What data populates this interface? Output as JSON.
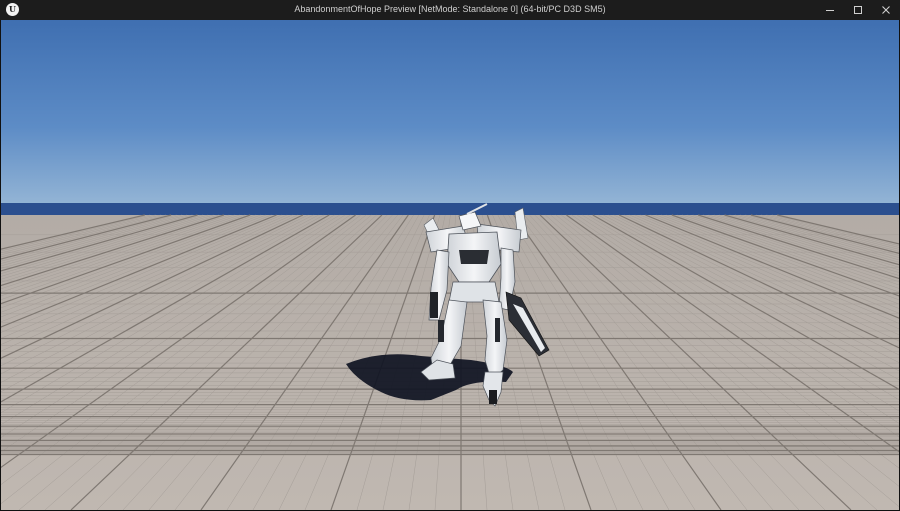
{
  "window": {
    "title": "AbandonmentOfHope Preview [NetMode: Standalone 0]  (64-bit/PC D3D SM5)",
    "app_icon": "unreal-engine-logo",
    "app_icon_letter": "U",
    "controls": {
      "minimize_icon": "minimize-icon",
      "maximize_icon": "maximize-icon",
      "close_icon": "close-icon"
    }
  },
  "scene": {
    "sky_colors": [
      "#3f6fb1",
      "#6e9acc",
      "#9bbad7"
    ],
    "horizon_color": "#2b4f8f",
    "floor_color": "#b8b1aa",
    "grid_color": "#8f8882",
    "character": "white mech robot",
    "shadow_color": "#0f1422"
  }
}
